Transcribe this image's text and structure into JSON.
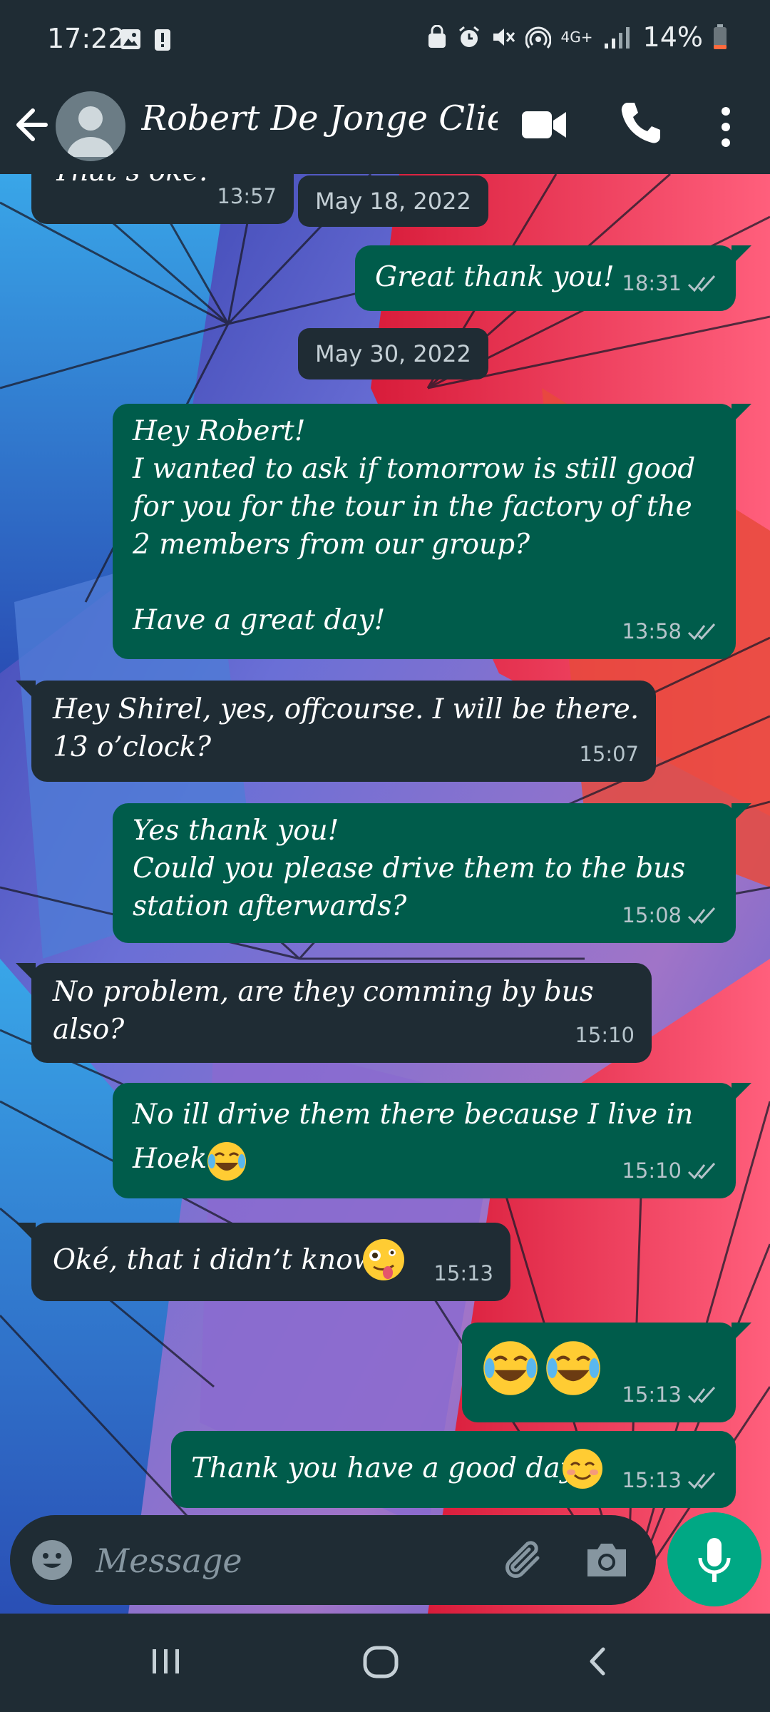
{
  "status_bar": {
    "time": "17:22",
    "network": "4G+",
    "battery": "14%",
    "icons": [
      "gallery-icon",
      "alert-icon",
      "lock-icon",
      "alarm-icon",
      "mute-icon",
      "hotspot-icon",
      "signal-icon",
      "battery-icon"
    ]
  },
  "header": {
    "contact_name": "Robert De Jonge Clie...",
    "icons": [
      "back-arrow-icon",
      "avatar-icon",
      "video-call-icon",
      "voice-call-icon",
      "kebab-menu-icon"
    ]
  },
  "messages": [
    {
      "direction": "in",
      "text": "That’s oke.",
      "time": "13:57"
    },
    {
      "type": "date",
      "text": "May 18, 2022"
    },
    {
      "direction": "out",
      "text": "Great thank you!",
      "time": "18:31",
      "status": "read"
    },
    {
      "type": "date",
      "text": "May 30, 2022"
    },
    {
      "direction": "out",
      "text": "Hey Robert!\nI wanted to ask if tomorrow is still good\nfor you for the tour in the factory of the\n2 members from our group?\n\nHave a great day!",
      "time": "13:58",
      "status": "read"
    },
    {
      "direction": "in",
      "text": "Hey Shirel, yes, offcourse. I will be there.\n13 o’clock?",
      "time": "15:07"
    },
    {
      "direction": "out",
      "text": "Yes thank you!\nCould you please drive them to the bus\nstation afterwards?",
      "time": "15:08",
      "status": "read"
    },
    {
      "direction": "in",
      "text": "No problem, are they comming by bus also?",
      "time": "15:10"
    },
    {
      "direction": "out",
      "text": "No ill drive them there because I live in\nHoek",
      "emoji": "tears-of-joy",
      "time": "15:10",
      "status": "read"
    },
    {
      "direction": "in",
      "text": "Oké, that i didn’t know",
      "emoji": "zany-face",
      "time": "15:13"
    },
    {
      "direction": "out",
      "text": "",
      "emoji": "tears-of-joy x2",
      "time": "15:13",
      "status": "read"
    },
    {
      "direction": "out",
      "text": "Thank you have a good day",
      "emoji": "smiling-face",
      "time": "15:13",
      "status": "read"
    }
  ],
  "input": {
    "placeholder": "Message",
    "icons": [
      "emoji-icon",
      "attach-icon",
      "camera-icon",
      "mic-icon"
    ]
  },
  "nav_bar": {
    "icons": [
      "recents-icon",
      "home-icon",
      "back-icon"
    ]
  },
  "colors": {
    "header_bg": "#1f2c34",
    "bubble_in": "#1f2c34",
    "bubble_out": "#005c4b",
    "accent": "#00a884",
    "read_ticks": "#b6c4cb"
  }
}
